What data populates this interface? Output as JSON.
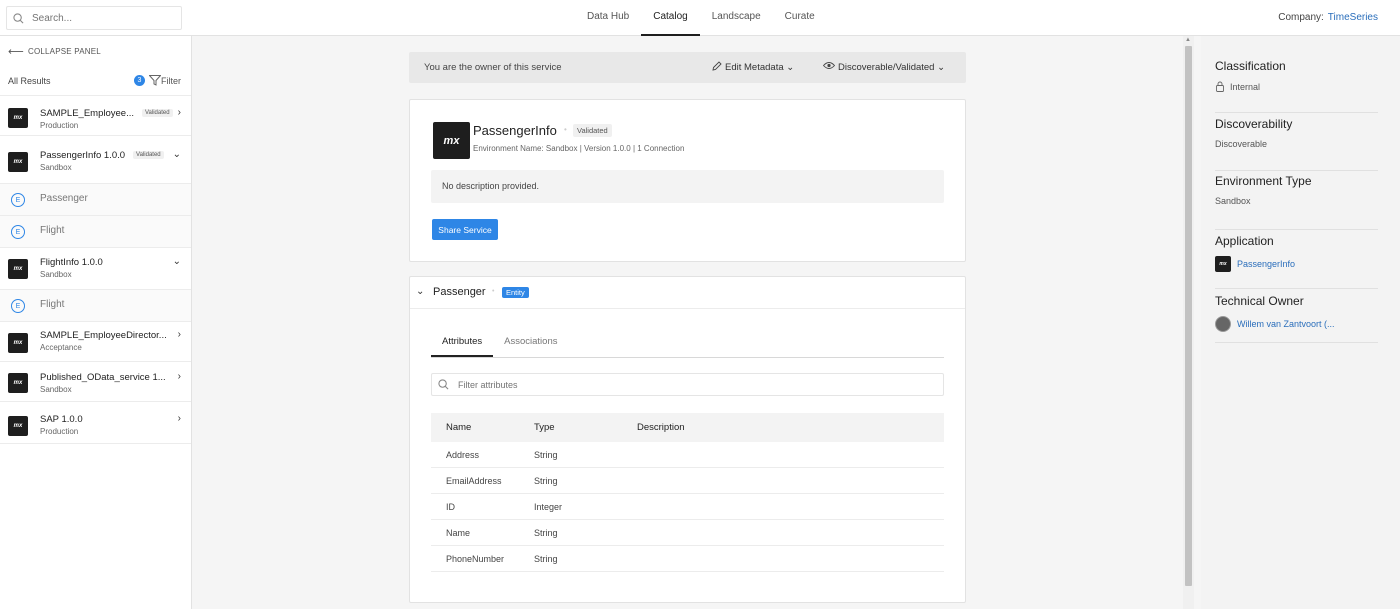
{
  "topbar": {
    "search_placeholder": "Search...",
    "nav": [
      "Data Hub",
      "Catalog",
      "Landscape",
      "Curate"
    ],
    "company_label": "Company:",
    "company_value": "TimeSeries"
  },
  "left": {
    "collapse": "COLLAPSE PANEL",
    "results_label": "All Results",
    "results_count": "3",
    "filter_label": "Filter",
    "items": [
      {
        "name": "SAMPLE_Employee...",
        "env": "Production",
        "tag": "Validated"
      },
      {
        "name": "PassengerInfo 1.0.0",
        "env": "Sandbox",
        "tag": "Validated"
      },
      {
        "name": "FlightInfo 1.0.0",
        "env": "Sandbox",
        "tag": ""
      },
      {
        "name": "SAMPLE_EmployeeDirector...",
        "env": "Acceptance",
        "tag": ""
      },
      {
        "name": "Published_OData_service 1...",
        "env": "Sandbox",
        "tag": ""
      },
      {
        "name": "SAP 1.0.0",
        "env": "Production",
        "tag": ""
      }
    ],
    "subitems": [
      "Passenger",
      "Flight",
      "Flight"
    ],
    "entity_letter": "E",
    "logo_text": "mx"
  },
  "owner_bar": {
    "text": "You are the owner of this service",
    "edit": "Edit Metadata",
    "disc": "Discoverable/Validated"
  },
  "service": {
    "name": "PassengerInfo",
    "tag": "Validated",
    "meta": "Environment Name: Sandbox | Version 1.0.0 | 1 Connection",
    "description": "No description provided.",
    "share": "Share Service"
  },
  "entity": {
    "name": "Passenger",
    "tag": "Entity",
    "tabs": [
      "Attributes",
      "Associations"
    ],
    "filter_placeholder": "Filter attributes",
    "columns": [
      "Name",
      "Type",
      "Description"
    ],
    "rows": [
      {
        "name": "Address",
        "type": "String",
        "desc": ""
      },
      {
        "name": "EmailAddress",
        "type": "String",
        "desc": ""
      },
      {
        "name": "ID",
        "type": "Integer",
        "desc": ""
      },
      {
        "name": "Name",
        "type": "String",
        "desc": ""
      },
      {
        "name": "PhoneNumber",
        "type": "String",
        "desc": ""
      }
    ]
  },
  "right": {
    "classification": {
      "h": "Classification",
      "v": "Internal"
    },
    "discoverability": {
      "h": "Discoverability",
      "v": "Discoverable"
    },
    "environment": {
      "h": "Environment Type",
      "v": "Sandbox"
    },
    "application": {
      "h": "Application",
      "v": "PassengerInfo"
    },
    "owner": {
      "h": "Technical Owner",
      "v": "Willem van Zantvoort (..."
    }
  },
  "colors": {
    "accent": "#2e86e6",
    "link": "#2a6ebb",
    "logo": "#1e1e1e"
  }
}
